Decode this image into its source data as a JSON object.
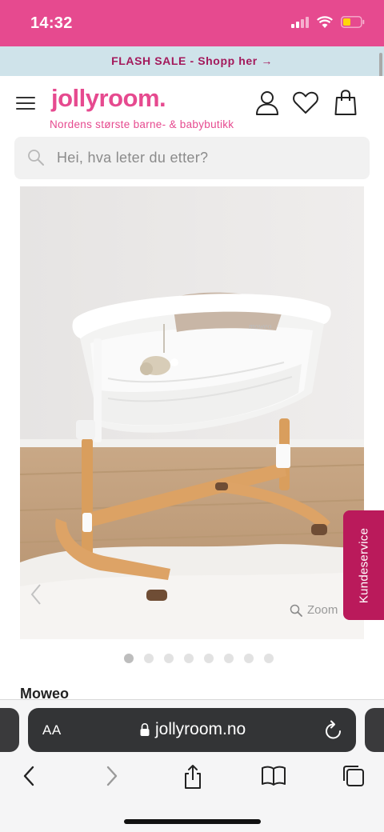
{
  "status_bar": {
    "time": "14:32"
  },
  "banner": {
    "text": "FLASH SALE - Shopp her →"
  },
  "header": {
    "logo": "jollyroom.",
    "tagline": "Nordens største barne- & babybutikk",
    "icons": [
      "menu-icon",
      "user-icon",
      "heart-icon",
      "bag-icon"
    ]
  },
  "search": {
    "placeholder": "Hei, hva leter du etter?"
  },
  "gallery": {
    "zoom_label": "Zoom",
    "total_images": 8,
    "active_index": 0
  },
  "customer_service": {
    "label": "Kundeservice"
  },
  "product": {
    "brand": "Moweo"
  },
  "browser": {
    "text_size_label": "AA",
    "url": "jollyroom.no"
  },
  "colors": {
    "brand_pink": "#e64a8f",
    "service_tab": "#ba1a5b",
    "banner_bg": "#cfe3ea",
    "banner_text": "#a3195b"
  }
}
